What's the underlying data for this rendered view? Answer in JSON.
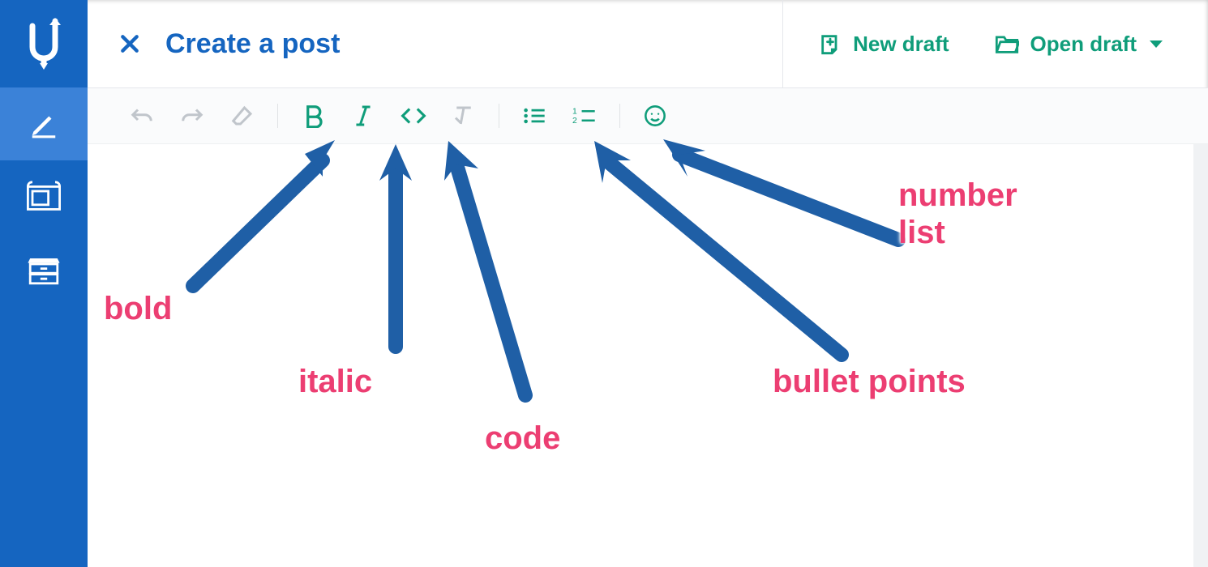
{
  "header": {
    "title": "Create a post",
    "actions": {
      "new_draft": "New draft",
      "open_draft": "Open draft"
    }
  },
  "sidebar": {
    "items": [
      {
        "name": "compose",
        "active": true
      },
      {
        "name": "templates",
        "active": false
      },
      {
        "name": "archive",
        "active": false
      }
    ]
  },
  "toolbar": {
    "buttons": [
      {
        "name": "undo",
        "enabled": false,
        "group": 1
      },
      {
        "name": "redo",
        "enabled": false,
        "group": 1
      },
      {
        "name": "clear-format",
        "enabled": false,
        "group": 1
      },
      {
        "name": "bold",
        "enabled": true,
        "group": 2
      },
      {
        "name": "italic",
        "enabled": true,
        "group": 2
      },
      {
        "name": "code",
        "enabled": true,
        "group": 2
      },
      {
        "name": "remove-format",
        "enabled": false,
        "group": 2
      },
      {
        "name": "bullet-list",
        "enabled": true,
        "group": 3
      },
      {
        "name": "number-list",
        "enabled": true,
        "group": 3
      },
      {
        "name": "emoji",
        "enabled": true,
        "group": 4
      }
    ]
  },
  "annotations": {
    "bold": "bold",
    "italic": "italic",
    "code": "code",
    "bullet_points": "bullet points",
    "number_list": "number\nlist"
  },
  "colors": {
    "brand_blue": "#1565c0",
    "teal": "#0f9d7a",
    "annotation_pink": "#ec3e72",
    "arrow_blue": "#1f5fa6"
  }
}
